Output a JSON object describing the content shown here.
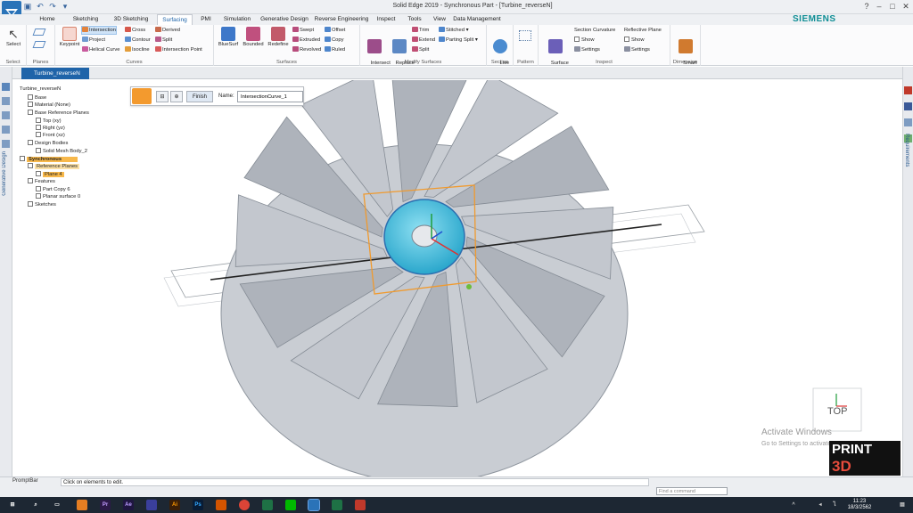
{
  "app": {
    "window_title": "Solid Edge 2019 - Synchronous Part - [Turbine_reverseN]",
    "brand": "SIEMENS"
  },
  "tabs": [
    "Home",
    "Sketching",
    "3D Sketching",
    "Surfacing",
    "PMI",
    "Simulation",
    "Generative Design",
    "Reverse Engineering",
    "Inspect",
    "Tools",
    "View",
    "Data Management"
  ],
  "active_tab": "Surfacing",
  "ribbon": {
    "select": {
      "label": "Select",
      "group": "Select"
    },
    "planes": {
      "group": "Planes"
    },
    "curves": {
      "keypoint": "Keypoint",
      "intersection": "Intersection",
      "project": "Project",
      "helical": "Helical Curve",
      "cross": "Cross",
      "contour": "Contour",
      "isocline": "Isocline",
      "derived": "Derived",
      "split": "Split",
      "intersection_point": "Intersection Point",
      "group": "Curves"
    },
    "surfaces": {
      "bluesurf": "BlueSurf",
      "bounded": "Bounded",
      "redefine": "Redefine",
      "swept": "Swept",
      "extruded": "Extruded",
      "revolved": "Revolved",
      "offset": "Offset",
      "copy": "Copy",
      "ruled": "Ruled",
      "group": "Surfaces"
    },
    "modify": {
      "intersect": "Intersect",
      "replace_face": "Replace\nFace",
      "trim": "Trim",
      "extend": "Extend",
      "split": "Split",
      "stitched": "Stitched",
      "parting_split": "Parting Split",
      "group": "Modify Surfaces"
    },
    "section": {
      "live": "Live\nSection",
      "group": "Section"
    },
    "pattern": {
      "group": "Pattern"
    },
    "inspect": {
      "surface_vis": "Surface\nVisualization",
      "section_curvature": "Section Curvature",
      "show1": "Show",
      "settings1": "Settings",
      "reflective_plane": "Reflective Plane",
      "show2": "Show",
      "settings2": "Settings",
      "group": "Inspect"
    },
    "dimension": {
      "smart": "Smart\nDimension",
      "group": "Dimension"
    }
  },
  "doc_tab": "Turbine_reverseN",
  "side_labels": {
    "left": "Generative Design",
    "right": "Requirements"
  },
  "tree": [
    {
      "label": "Turbine_reverseN",
      "level": 0
    },
    {
      "label": "Base",
      "level": 1
    },
    {
      "label": "Material (None)",
      "level": 1
    },
    {
      "label": "Base Reference Planes",
      "level": 1
    },
    {
      "label": "Top (xy)",
      "level": 2
    },
    {
      "label": "Right (yz)",
      "level": 2
    },
    {
      "label": "Front (xz)",
      "level": 2
    },
    {
      "label": "Design Bodies",
      "level": 1
    },
    {
      "label": "Solid Mesh Body_2",
      "level": 2
    },
    {
      "label": "Synchronous",
      "level": 0
    },
    {
      "label": "Reference Planes",
      "level": 1
    },
    {
      "label": "Plane 4",
      "level": 2
    },
    {
      "label": "Features",
      "level": 1
    },
    {
      "label": "Part Copy 6",
      "level": 2
    },
    {
      "label": "Planar surface 0",
      "level": 2
    },
    {
      "label": "Sketches",
      "level": 1
    }
  ],
  "command_bar": {
    "finish": "Finish",
    "name_label": "Name:",
    "name_value": "IntersectionCurve_1"
  },
  "viewcube_label": "TOP",
  "watermark": {
    "line1": "Activate Windows",
    "line2": "Go to Settings to activate"
  },
  "logo": {
    "line1": "PRINT",
    "line2": "3D"
  },
  "prompt": {
    "title": "PromptBar",
    "text": "Click on elements to edit."
  },
  "find_command_placeholder": "Find a command",
  "clock": {
    "time": "11:23",
    "date": "18/3/2562"
  },
  "colors": {
    "accent": "#1f64a9",
    "selection": "#f7b84b",
    "hub": "#3db8d8",
    "brand": "#0f8e95"
  }
}
